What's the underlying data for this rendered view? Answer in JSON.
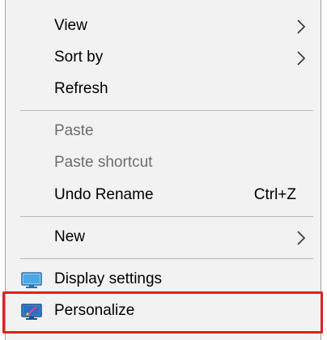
{
  "context_menu": {
    "items": [
      {
        "label": "View",
        "submenu": true
      },
      {
        "label": "Sort by",
        "submenu": true
      },
      {
        "label": "Refresh"
      },
      {
        "label": "Paste",
        "disabled": true
      },
      {
        "label": "Paste shortcut",
        "disabled": true
      },
      {
        "label": "Undo Rename",
        "shortcut": "Ctrl+Z"
      },
      {
        "label": "New",
        "submenu": true
      },
      {
        "label": "Display settings",
        "icon": "display-settings-icon"
      },
      {
        "label": "Personalize",
        "icon": "personalize-icon"
      }
    ]
  },
  "colors": {
    "menu_background": "#f2f2f2",
    "highlight_border": "#e02020",
    "disabled_text": "#6d6d6d"
  }
}
